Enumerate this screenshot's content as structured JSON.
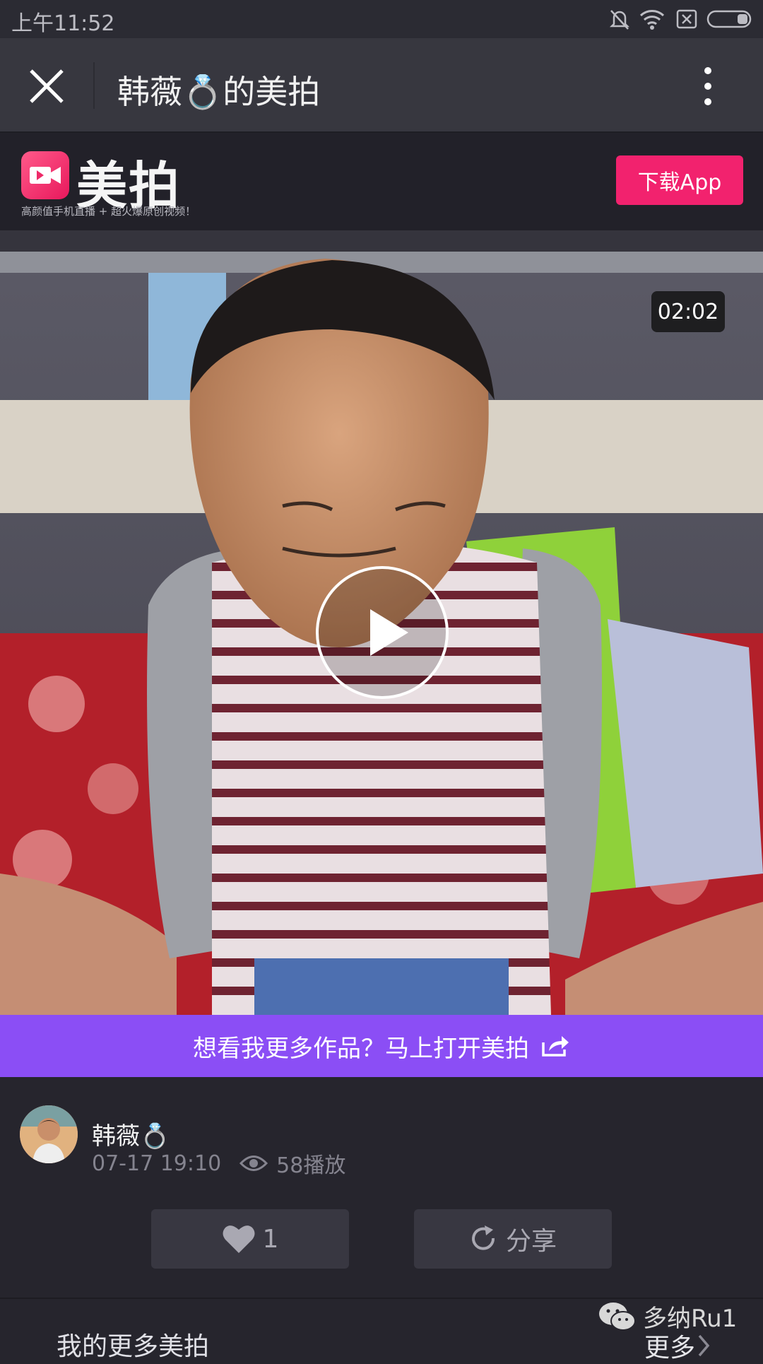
{
  "status_bar": {
    "time": "上午11:52"
  },
  "titlebar": {
    "title": "韩薇💍的美拍"
  },
  "header": {
    "logo_text": "美拍",
    "slogan": "高颜值手机直播 + 超火爆原创视频！",
    "download_label": "下载App"
  },
  "video": {
    "duration": "02:02"
  },
  "banner": {
    "text": "想看我更多作品？马上打开美拍"
  },
  "user": {
    "name": "韩薇💍",
    "datetime": "07-17 19:10",
    "plays": "58播放"
  },
  "actions": {
    "like_count": "1",
    "share_label": "分享"
  },
  "more": {
    "title": "我的更多美拍",
    "link": "更多",
    "watermark": "多纳Ru1"
  },
  "colors": {
    "accent_pink": "#f2226e",
    "banner_purple": "#8b4ef5",
    "background": "#26252d"
  }
}
